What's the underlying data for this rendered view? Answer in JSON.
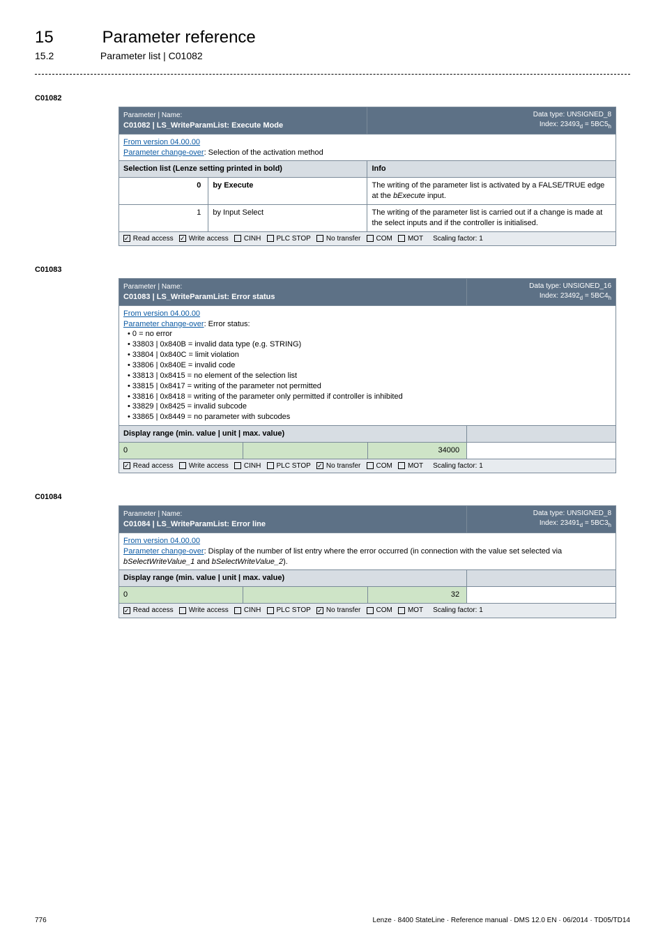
{
  "header": {
    "chapter_num": "15",
    "chapter_title": "Parameter reference",
    "section_num": "15.2",
    "section_title": "Parameter list | C01082"
  },
  "anchors": {
    "a1": "C01082",
    "a2": "C01083",
    "a3": "C01084"
  },
  "t1": {
    "top_label": "Parameter | Name:",
    "title": "C01082 | LS_WriteParamList: Execute Mode",
    "dtype_label": "Data type: UNSIGNED_8",
    "index_label": "Index: 23493",
    "index_sub_d": "d",
    "index_eq": " = 5BC5",
    "index_sub_h": "h",
    "from_version": "From version 04.00.00",
    "change_over_link": "Parameter change-over",
    "change_over_suffix": ": Selection of the activation method",
    "col1_header": "Selection list (Lenze setting printed in bold)",
    "col2_header": "Info",
    "rows": [
      {
        "num": "0",
        "label": "by Execute",
        "bold": true,
        "info_prefix": "The writing of the parameter list is activated by a FALSE/TRUE edge at the ",
        "info_italic": "bExecute",
        "info_suffix": " input."
      },
      {
        "num": "1",
        "label": "by Input Select",
        "bold": false,
        "info": "The writing of the parameter list is carried out if a change is made at the select inputs and if the controller is initialised."
      }
    ],
    "symbols": {
      "read": "Read access",
      "write": "Write access",
      "cinh": "CINH",
      "plc": "PLC STOP",
      "notransfer": "No transfer",
      "com": "COM",
      "mot": "MOT",
      "scaling": "Scaling factor: 1"
    }
  },
  "t2": {
    "top_label": "Parameter | Name:",
    "title": "C01083 | LS_WriteParamList: Error status",
    "dtype_label": "Data type: UNSIGNED_16",
    "index_label": "Index: 23492",
    "index_sub_d": "d",
    "index_eq": " = 5BC4",
    "index_sub_h": "h",
    "from_version": "From version 04.00.00",
    "change_over_link": "Parameter change-over",
    "change_over_suffix": ": Error status:",
    "bullets": [
      "0 = no error",
      "33803 | 0x840B = invalid data type (e.g. STRING)",
      "33804 | 0x840C = limit violation",
      "33806 | 0x840E = invalid code",
      "33813 | 0x8415 = no element of the selection list",
      "33815 | 0x8417 = writing of the parameter not permitted",
      "33816 | 0x8418 = writing of the parameter only permitted if controller is inhibited",
      "33829 | 0x8425 = invalid subcode",
      "33865 | 0x8449 = no parameter with subcodes"
    ],
    "display_header": "Display range (min. value | unit | max. value)",
    "min": "0",
    "max": "34000",
    "symbols": {
      "read": "Read access",
      "write": "Write access",
      "cinh": "CINH",
      "plc": "PLC STOP",
      "notransfer": "No transfer",
      "com": "COM",
      "mot": "MOT",
      "scaling": "Scaling factor: 1"
    }
  },
  "t3": {
    "top_label": "Parameter | Name:",
    "title": "C01084 | LS_WriteParamList: Error line",
    "dtype_label": "Data type: UNSIGNED_8",
    "index_label": "Index: 23491",
    "index_sub_d": "d",
    "index_eq": " = 5BC3",
    "index_sub_h": "h",
    "from_version": "From version 04.00.00",
    "change_over_link": "Parameter change-over",
    "body_after_link": ": Display of the number of list entry where the error occurred (in connection with the value set selected via ",
    "italic1": "bSelectWriteValue_1",
    "body_and": " and ",
    "italic2": "bSelectWriteValue_2",
    "body_end": ").",
    "display_header": "Display range (min. value | unit | max. value)",
    "min": "0",
    "max": "32",
    "symbols": {
      "read": "Read access",
      "write": "Write access",
      "cinh": "CINH",
      "plc": "PLC STOP",
      "notransfer": "No transfer",
      "com": "COM",
      "mot": "MOT",
      "scaling": "Scaling factor: 1"
    }
  },
  "footer": {
    "page": "776",
    "right": "Lenze · 8400 StateLine · Reference manual · DMS 12.0 EN · 06/2014 · TD05/TD14"
  }
}
